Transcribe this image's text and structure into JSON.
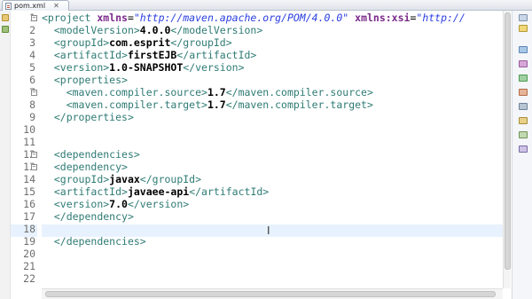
{
  "editor": {
    "tab_title": "pom.xml",
    "tab_close": "✕",
    "cursor_glyph": "I"
  },
  "line_numbers": [
    "1",
    "2",
    "3",
    "4",
    "5",
    "6",
    "7",
    "8",
    "9",
    "10",
    "11",
    "12",
    "13",
    "14",
    "15",
    "16",
    "17",
    "18",
    "19",
    "20",
    "21",
    "22"
  ],
  "fold_markers": {
    "l1": "−",
    "l7": "−",
    "l12": "−",
    "l13": "−"
  },
  "code": {
    "l1": {
      "open": "<project ",
      "a1": "xmlns",
      "eq1": "=",
      "v1": "\"http://maven.apache.org/POM/4.0.0\"",
      "sp": " ",
      "a2": "xmlns:xsi",
      "eq2": "=",
      "v2": "\"http://"
    },
    "l2": {
      "indent": "  ",
      "open": "<modelVersion>",
      "text": "4.0.0",
      "close": "</modelVersion>"
    },
    "l3": {
      "indent": "  ",
      "open": "<groupId>",
      "text": "com.esprit",
      "close": "</groupId>"
    },
    "l4": {
      "indent": "  ",
      "open": "<artifactId>",
      "text": "firstEJB",
      "close": "</artifactId>"
    },
    "l5": {
      "indent": "  ",
      "open": "<version>",
      "text": "1.0-SNAPSHOT",
      "close": "</version>"
    },
    "l6": {
      "indent": "  ",
      "open": "<properties>"
    },
    "l7": {
      "indent": "    ",
      "open": "<maven.compiler.source>",
      "text": "1.7",
      "close": "</maven.compiler.source>"
    },
    "l8": {
      "indent": "    ",
      "open": "<maven.compiler.target>",
      "text": "1.7",
      "close": "</maven.compiler.target>"
    },
    "l9": {
      "indent": "  ",
      "close": "</properties>"
    },
    "l12": {
      "indent": "  ",
      "open": "<dependencies>"
    },
    "l13": {
      "indent": "  ",
      "open": "<dependency>"
    },
    "l14": {
      "indent": "  ",
      "open": "<groupId>",
      "text": "javax",
      "close": "</groupId>"
    },
    "l15": {
      "indent": "  ",
      "open": "<artifactId>",
      "text": "javaee-api",
      "close": "</artifactId>"
    },
    "l16": {
      "indent": "  ",
      "open": "<version>",
      "text": "7.0",
      "close": "</version>"
    },
    "l17": {
      "indent": "  ",
      "close": "</dependency>"
    },
    "l19": {
      "indent": "  ",
      "close": "</dependencies>"
    }
  },
  "colors": {
    "tag": "#2e7b74",
    "attr": "#7a2a8a",
    "attr_value": "#2a3ee0",
    "current_line": "#e8f2fe"
  }
}
